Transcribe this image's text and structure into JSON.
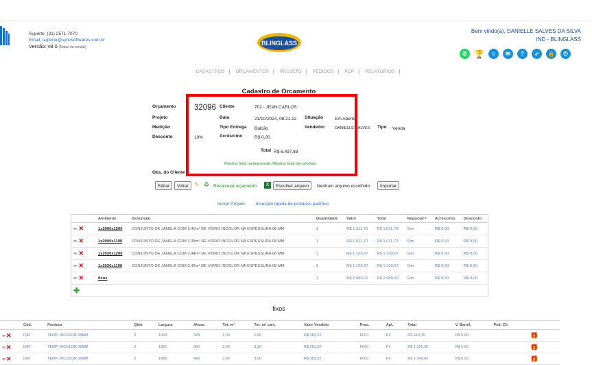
{
  "header": {
    "support_phone": "Suporte: (31) 2571-7070",
    "support_email": "Email: suporte@syncsoftwares.com.br",
    "version": "Versão: v8.0",
    "version_notes": "(Notas da versão)",
    "brand": "BLINGLASS",
    "welcome_line1": "Bem vindo(a), DANIELLE SALVES DA SILVA",
    "welcome_line2": "IND - BLINGLASS"
  },
  "nav": [
    "CADASTROS",
    "ORÇAMENTOS",
    "PROJETO",
    "PEDIDOS",
    "PCP",
    "RELATÓRIOS"
  ],
  "page_title": "Cadastro de Orcamento",
  "form": {
    "orcamento_label": "Orçamento",
    "orcamento_value": "32096",
    "projeto_label": "Projeto",
    "medicao_label": "Medição",
    "desconto_label": "Desconto",
    "desconto_value": "10%",
    "cliente_label": "Cliente",
    "cliente_value": "702 - JEAN CARLOS",
    "data_label": "Data",
    "data_value": "21/10/2024, 08:21:22",
    "situacao_label": "Situação",
    "situacao_value": "Em Aberto",
    "tipo_entrega_label": "Tipo Entrega",
    "tipo_entrega_value": "Balcão",
    "vendedor_label": "Vendedor",
    "vendedor_value": "DANIELLE SALVES",
    "tipo_label": "Tipo",
    "tipo_value": "Venda",
    "acrescimo_label": "Acréscimo",
    "acrescimo_value": "R$ 0,00",
    "total_label": "Total",
    "total_value": "R$ 6.497,88",
    "mostrar_total_impressao": "Mostrar total na impressão",
    "mostrar_total_produto": "Mostrar total por produto",
    "obs_label": "Obs. do Cliente"
  },
  "toolbar": {
    "editar": "Editar",
    "voltar": "Voltar",
    "recalcular": "Recalcular orçamento",
    "escolher": "Escolher arquivo",
    "nenhum": "Nenhum arquivo escolhido",
    "importar": "Importar"
  },
  "links": {
    "incluir_projeto": "Incluir Projeto",
    "insercao": "Inserção rápida de produtos padrões"
  },
  "env_table": {
    "headers": [
      "Ambiente",
      "Descrição",
      "Quantidade",
      "Valor",
      "Total",
      "Negociar?",
      "Acréscimo",
      "Desconto"
    ],
    "rows": [
      {
        "cod": "1x2000x1200",
        "desc": "CONJUNTO DE JANELA COM 2,40m² DE VIDRO INCOLOR NA ESPESSURA 08 MM",
        "qtd": "1",
        "valor": "R$ 1.011,70",
        "total": "R$ 1.011,70",
        "neg": "Sim",
        "acr": "R$ 0,00",
        "desc2": "R$ 0,00"
      },
      {
        "cod": "1x2000x1190",
        "desc": "CONJUNTO DE JANELA COM 2,38m² DE VIDRO INCOLOR NA ESPESSURA 08 MM",
        "qtd": "1",
        "valor": "R$ 1.011,70",
        "total": "R$ 1.011,70",
        "neg": "Sim",
        "acr": "R$ 0,00",
        "desc2": "R$ 0,00"
      },
      {
        "cod": "1x2030x1200",
        "desc": "CONJUNTO DE JANELA COM 2,44m² DE VIDRO INCOLOR NA ESPESSURA 08 MM",
        "qtd": "1",
        "valor": "R$ 1.103,67",
        "total": "R$ 1.103,67",
        "neg": "Sim",
        "acr": "R$ 0,00",
        "desc2": "R$ 0,00"
      },
      {
        "cod": "1x2030x1190",
        "desc": "CONJUNTO DE JANELA COM 2,42m² DE VIDRO INCOLOR NA ESPESSURA 08 MM",
        "qtd": "1",
        "valor": "R$ 1.103,67",
        "total": "R$ 1.103,67",
        "neg": "Sim",
        "acr": "R$ 0,00",
        "desc2": "R$ 0,00"
      },
      {
        "cod": "fixos",
        "desc": "",
        "qtd": "1",
        "valor": "R$ 2.989,12",
        "total": "R$ 2.989,12",
        "neg": "Sim",
        "acr": "R$ 0,00",
        "desc2": "R$ 0,00"
      }
    ]
  },
  "fixos_title": "fixos",
  "prod_table": {
    "headers": [
      "Cód.",
      "Produto",
      "Qtde",
      "Largura",
      "Altura",
      "Tot. m²",
      "Tot. m² calc.",
      "Valor Vendido",
      "Proc.",
      "Apl.",
      "Total",
      "V. Benef.",
      "Ped. Cli."
    ],
    "rows": [
      {
        "cod": "I08T",
        "prod": "TEMP. INCOLOR 08MM",
        "qtde": "2",
        "larg": "1943",
        "alt": "328",
        "tot": "1,60",
        "totc": "1,60",
        "vv": "R$ 383,22",
        "proc": "FIXO",
        "apl": "FX",
        "total": "R$ 613,15",
        "vb": "R$ 0,00"
      },
      {
        "cod": "I08T",
        "prod": "TEMP. INCOLOR 08MM",
        "qtde": "2",
        "larg": "1920",
        "alt": "800",
        "tot": "3,20",
        "totc": "3,20",
        "vv": "R$ 383,22",
        "proc": "FIXO",
        "apl": "FX",
        "total": "R$ 1.226,30",
        "vb": "R$ 0,00"
      },
      {
        "cod": "I08T",
        "prod": "TEMP. INCOLOR 08MM",
        "qtde": "2",
        "larg": "1485",
        "alt": "943",
        "tot": "3,00",
        "totc": "3,00",
        "vv": "R$ 383,22",
        "proc": "FIXO",
        "apl": "FX",
        "total": "R$ 1.149,66",
        "vb": "R$ 0,00"
      }
    ]
  }
}
